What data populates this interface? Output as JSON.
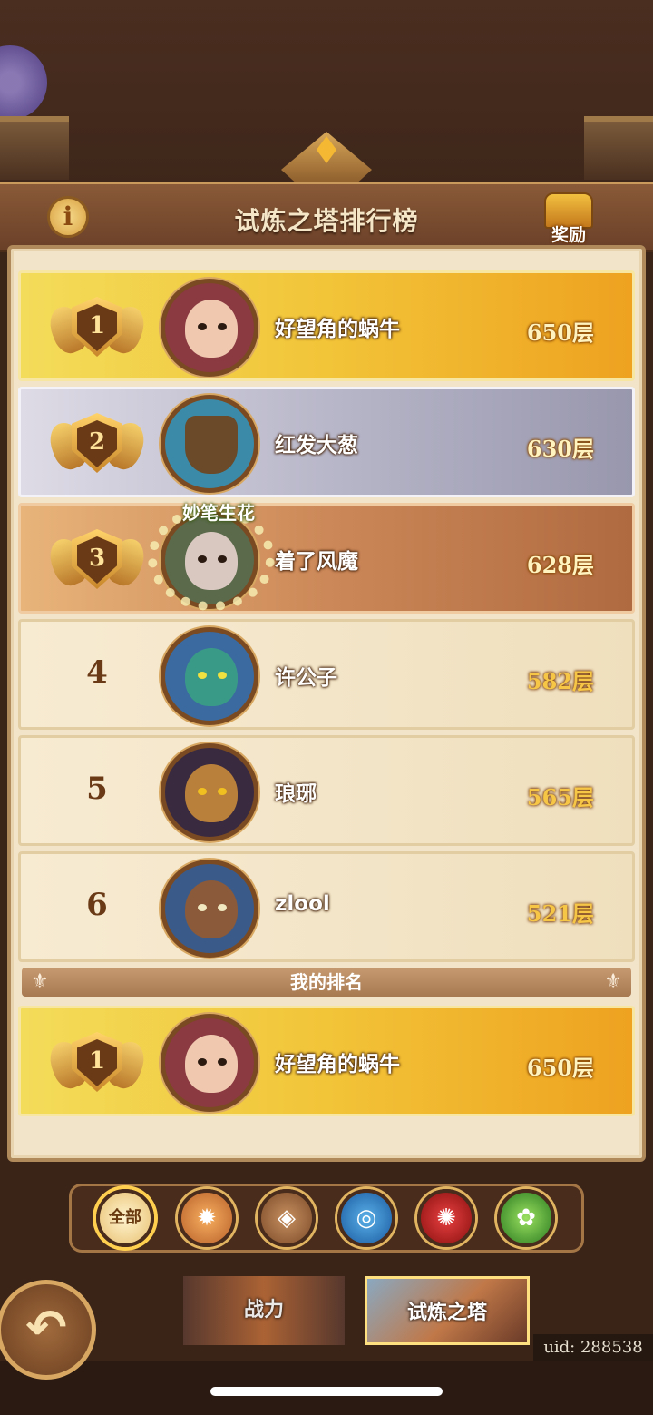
{
  "header": {
    "title": "试炼之塔排行榜",
    "info_icon": "info-icon",
    "reward_label": "奖励",
    "reward_icon": "treasure-chest-icon"
  },
  "leaderboard": {
    "rows": [
      {
        "rank": "1",
        "name": "好望角的蜗牛",
        "score": "650层",
        "style": "gold",
        "avatar_icon": "red-haired-hero-avatar"
      },
      {
        "rank": "2",
        "name": "红发大葱",
        "score": "630层",
        "style": "silver",
        "avatar_icon": "shield-hero-avatar"
      },
      {
        "rank": "3",
        "name": "着了风魔",
        "score": "628层",
        "style": "bronze",
        "avatar_icon": "elf-elder-avatar",
        "title_badge": "妙笔生花"
      },
      {
        "rank": "4",
        "name": "许公子",
        "score": "582层",
        "style": "plain",
        "avatar_icon": "blue-troll-avatar"
      },
      {
        "rank": "5",
        "name": "琅琊",
        "score": "565层",
        "style": "plain",
        "avatar_icon": "beast-hero-avatar"
      },
      {
        "rank": "6",
        "name": "zlool",
        "score": "521层",
        "style": "plain",
        "avatar_icon": "blue-haired-elf-avatar"
      }
    ]
  },
  "my_rank": {
    "label": "我的排名",
    "rank": "1",
    "name": "好望角的蜗牛",
    "score": "650层"
  },
  "filters": {
    "all_label": "全部",
    "factions": [
      "all-icon",
      "sun-faction-icon",
      "earth-faction-icon",
      "water-faction-icon",
      "fire-faction-icon",
      "wind-faction-icon"
    ]
  },
  "tabs": {
    "power": "战力",
    "tower": "试炼之塔"
  },
  "uid": "uid: 288538",
  "colors": {
    "gold": "#f2c438",
    "silver": "#b8b7c9",
    "bronze": "#cc8858",
    "plain": "#f3e5c6",
    "frame": "#3a2418"
  }
}
